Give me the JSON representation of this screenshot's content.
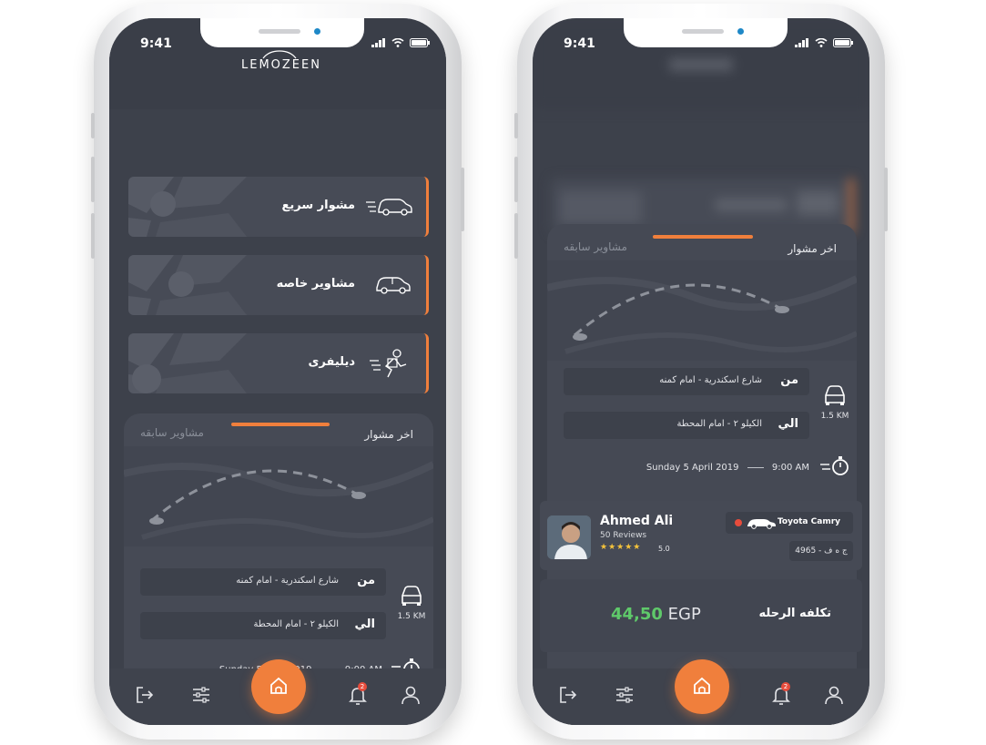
{
  "status": {
    "time": "9:41"
  },
  "app": {
    "logo_text": "LEMOZEEN"
  },
  "services": [
    {
      "label": "مشوار سريع",
      "icon": "fast-car-icon"
    },
    {
      "label": "مشاوير خاصه",
      "icon": "car-icon"
    },
    {
      "label": "ديليفرى",
      "icon": "delivery-icon"
    }
  ],
  "trip_sheet": {
    "tab_last": "اخر مشوار",
    "tab_previous": "مشاوير سابقه",
    "from_label": "من",
    "from_value": "شارع اسكندرية - امام كمنه",
    "to_label": "الي",
    "to_value": "الكيلو ٢ - امام المحطة",
    "distance": "1.5 KM",
    "date": "Sunday 5 April 2019",
    "time": "9:00 AM"
  },
  "driver": {
    "name": "Ahmed Ali",
    "reviews": "50 Reviews",
    "stars": "★★★★★",
    "rating": "5.0",
    "car_model": "Toyota Camry",
    "plate": "ج ه ف - 4965"
  },
  "fare": {
    "label": "تكلفه الرحله",
    "amount": "44,50",
    "currency": "EGP"
  },
  "navbar": {
    "notification_count": "2"
  },
  "colors": {
    "accent": "#f07f3c",
    "background": "#3d414b",
    "card": "#474b56",
    "price": "#5fc96a"
  }
}
